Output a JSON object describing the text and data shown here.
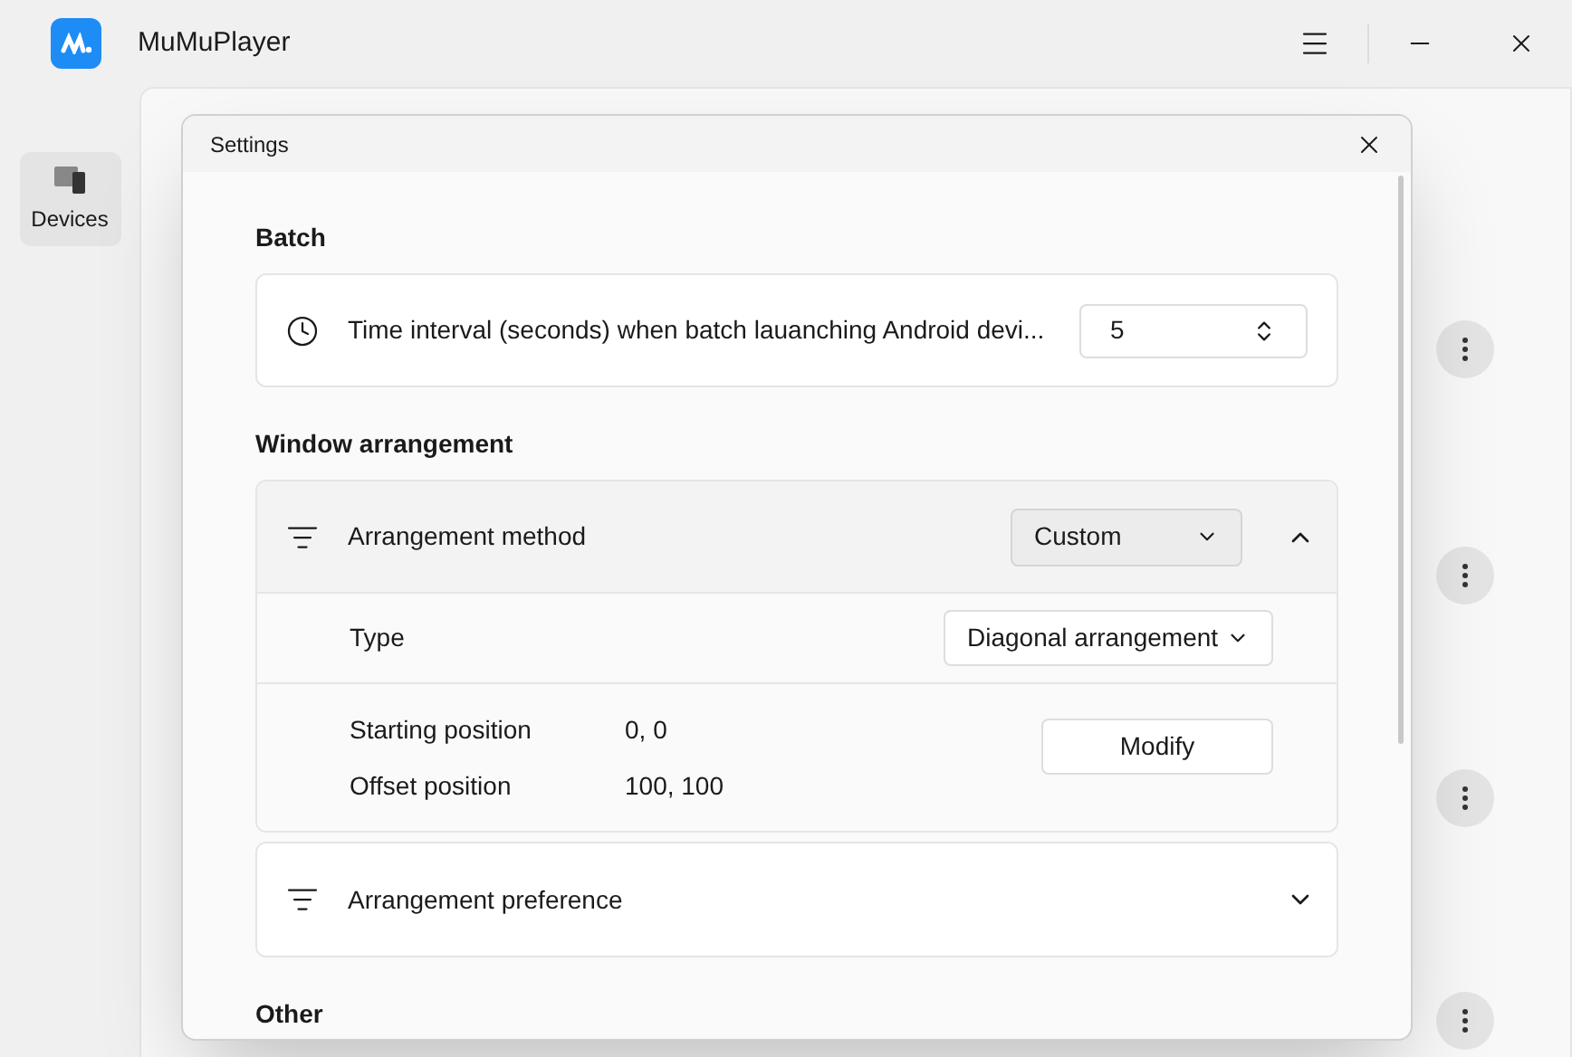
{
  "app": {
    "title": "MuMuPlayer"
  },
  "sidebar": {
    "items": [
      {
        "label": "Devices",
        "selected": true
      }
    ]
  },
  "dialog": {
    "title": "Settings",
    "sections": [
      {
        "heading": "Batch",
        "cards": [
          {
            "kind": "spinner",
            "label": "Time interval (seconds) when batch lauanching Android devi...",
            "value": "5"
          }
        ]
      },
      {
        "heading": "Window arrangement",
        "cards": [
          {
            "kind": "expander",
            "label": "Arrangement method",
            "value": "Custom",
            "expanded": true,
            "type_label": "Type",
            "type_value": "Diagonal arrangement",
            "positions": [
              {
                "label": "Starting position",
                "value": "0, 0"
              },
              {
                "label": "Offset position",
                "value": "100, 100"
              }
            ],
            "button": "Modify"
          },
          {
            "kind": "expander",
            "label": "Arrangement preference",
            "expanded": false
          }
        ]
      },
      {
        "heading": "Other"
      }
    ]
  }
}
